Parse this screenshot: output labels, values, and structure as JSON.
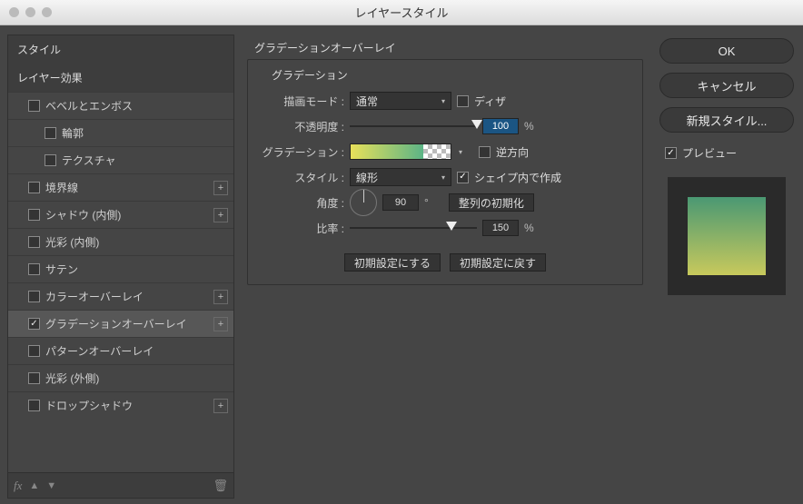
{
  "title": "レイヤースタイル",
  "sidebar": {
    "heading_style": "スタイル",
    "heading_effects": "レイヤー効果",
    "items": [
      {
        "label": "ベベルとエンボス",
        "checked": false,
        "indent": 1,
        "plus": false
      },
      {
        "label": "輪郭",
        "checked": false,
        "indent": 2,
        "plus": false
      },
      {
        "label": "テクスチャ",
        "checked": false,
        "indent": 2,
        "plus": false
      },
      {
        "label": "境界線",
        "checked": false,
        "indent": 1,
        "plus": true
      },
      {
        "label": "シャドウ (内側)",
        "checked": false,
        "indent": 1,
        "plus": true
      },
      {
        "label": "光彩 (内側)",
        "checked": false,
        "indent": 1,
        "plus": false
      },
      {
        "label": "サテン",
        "checked": false,
        "indent": 1,
        "plus": false
      },
      {
        "label": "カラーオーバーレイ",
        "checked": false,
        "indent": 1,
        "plus": true
      },
      {
        "label": "グラデーションオーバーレイ",
        "checked": true,
        "indent": 1,
        "plus": true,
        "selected": true
      },
      {
        "label": "パターンオーバーレイ",
        "checked": false,
        "indent": 1,
        "plus": false
      },
      {
        "label": "光彩 (外側)",
        "checked": false,
        "indent": 1,
        "plus": false
      },
      {
        "label": "ドロップシャドウ",
        "checked": false,
        "indent": 1,
        "plus": true
      }
    ]
  },
  "footer": {
    "fx": "fx",
    "up": "▲",
    "down": "▼",
    "trash": "🗑"
  },
  "main": {
    "section_title": "グラデーションオーバーレイ",
    "group_title": "グラデーション",
    "blend_mode_label": "描画モード :",
    "blend_mode_value": "通常",
    "dither_label": "ディザ",
    "dither_checked": false,
    "opacity_label": "不透明度 :",
    "opacity_value": "100",
    "opacity_unit": "%",
    "gradient_label": "グラデーション :",
    "reverse_label": "逆方向",
    "reverse_checked": false,
    "style_label": "スタイル :",
    "style_value": "線形",
    "align_label": "シェイプ内で作成",
    "align_checked": true,
    "angle_label": "角度 :",
    "angle_value": "90",
    "angle_unit": "°",
    "reset_align_btn": "整列の初期化",
    "scale_label": "比率 :",
    "scale_value": "150",
    "scale_unit": "%",
    "make_default_btn": "初期設定にする",
    "reset_default_btn": "初期設定に戻す"
  },
  "right": {
    "ok": "OK",
    "cancel": "キャンセル",
    "new_style": "新規スタイル...",
    "preview_label": "プレビュー",
    "preview_checked": true
  }
}
